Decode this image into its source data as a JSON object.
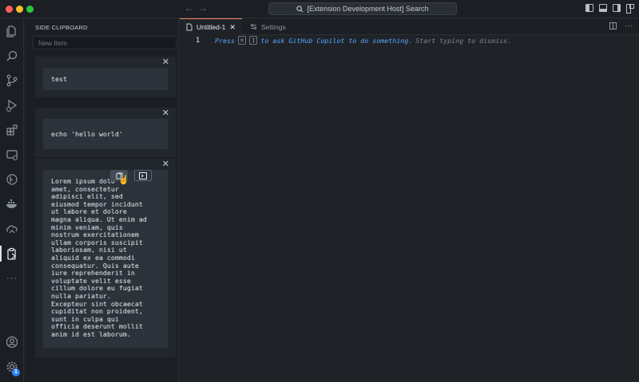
{
  "titlebar": {
    "command_center": "[Extension Development Host] Search",
    "back": "←",
    "forward": "→"
  },
  "activity_bar": {
    "icons": [
      "explorer-icon",
      "search-icon",
      "source-control-icon",
      "run-debug-icon",
      "extensions-icon",
      "remote-explorer-icon",
      "git-graph-icon",
      "docker-icon",
      "cloud-icon",
      "side-clipboard-icon",
      "more-icon",
      "accounts-icon",
      "manage-gear-icon"
    ],
    "more": "···",
    "manage_badge": "1"
  },
  "sidebar": {
    "title": "SIDE CLIPBOARD",
    "new_item_placeholder": "New Item",
    "close_glyph": "✕",
    "items": [
      {
        "text": "test"
      },
      {
        "text": "echo 'hello world'"
      },
      {
        "text": "Lorem ipsum dolo\namet, consectetur\nadipisci elit, sed\neiusmod tempor incidunt\nut labore et dolore\nmagna aliqua. Ut enim ad\nminim veniam, quis\nnostrum exercitationem\nullam corporis suscipit\nlaboriosam, nisi ut\naliquid ex ea commodi\nconsequatur. Quis aute\niure reprehenderit in\nvoluptate velit esse\ncillum dolore eu fugiat\nnulla pariatur.\nExcepteur sint obcaecat\ncupiditat non proident,\nsunt in culpa qui\nofficia deserunt mollit\nanim id est laborum."
      }
    ]
  },
  "editor": {
    "tabs": [
      {
        "label": "Untitled-1",
        "close": "✕"
      },
      {
        "label": "Settings"
      }
    ],
    "line_number": "1",
    "hint": {
      "press": "Press",
      "key1": "⌘",
      "key2": "I",
      "action": "to ask GitHub Copilot to do something.",
      "dismiss": "Start typing to dismiss."
    }
  },
  "colors": {
    "accent_tab": "#f78166",
    "hint_blue": "#58a6ff",
    "badge": "#2f81f7"
  }
}
